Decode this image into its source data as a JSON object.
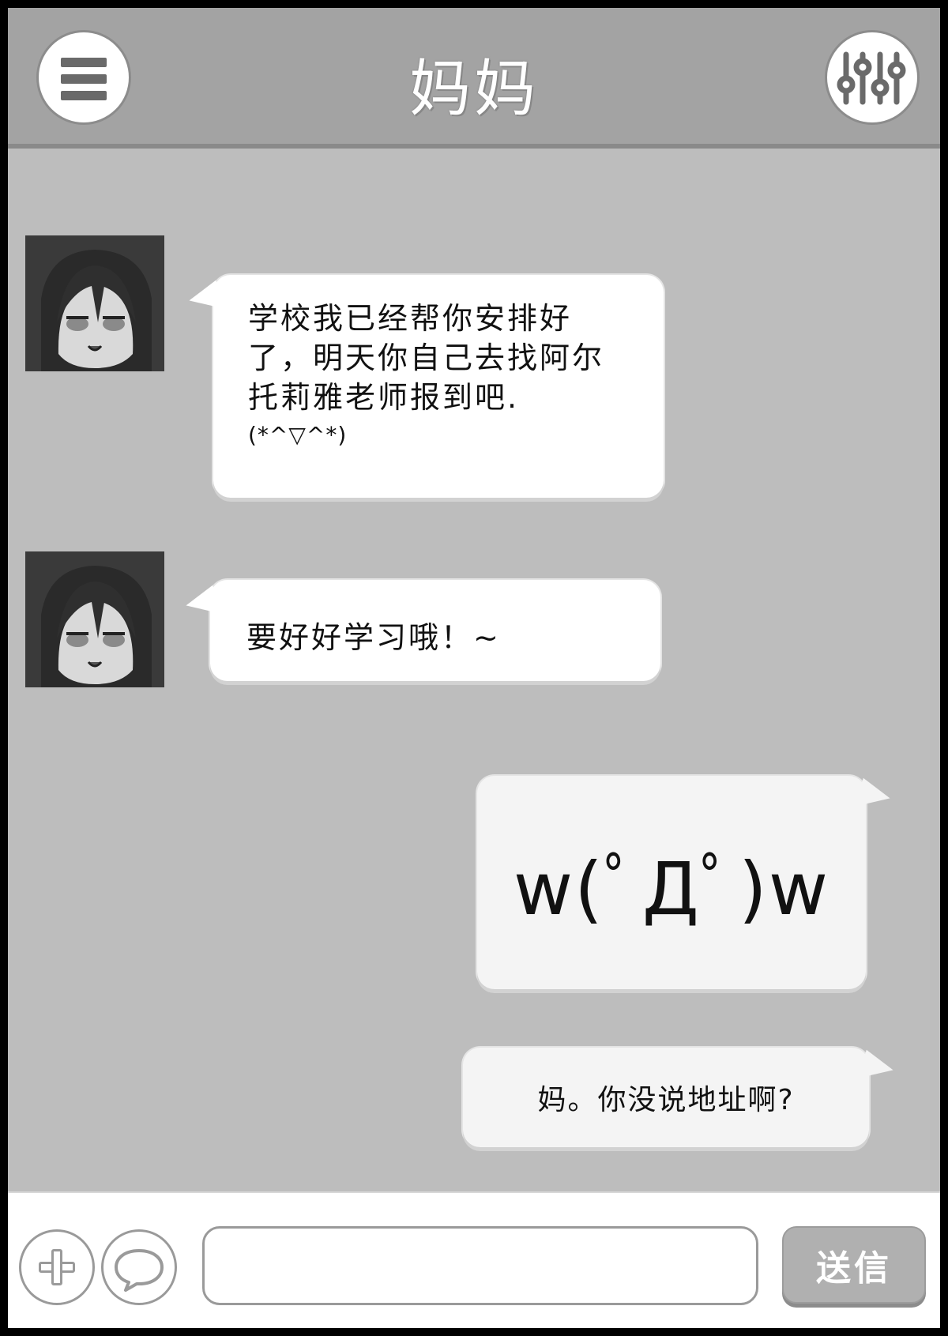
{
  "header": {
    "title": "妈妈",
    "menu_icon": "hamburger-menu-icon",
    "settings_icon": "equalizer-sliders-icon"
  },
  "messages": [
    {
      "from": "contact",
      "text": "学校我已经帮你安排好了，明天你自己去找阿尔托莉雅老师报到吧.",
      "emote": "(*^▽^*)"
    },
    {
      "from": "contact",
      "text": "要好好学习哦！~"
    },
    {
      "from": "me",
      "text": "w(ﾟДﾟ)w"
    },
    {
      "from": "me",
      "text": "妈。你没说地址啊?"
    }
  ],
  "input_bar": {
    "add_icon": "plus-icon",
    "emoji_icon": "speech-bubble-icon",
    "message_value": "",
    "send_label": "送信"
  },
  "colors": {
    "background": "#bdbdbd",
    "header": "#a3a3a3",
    "bubble": "#ffffff",
    "send_button": "#b0b0b0"
  }
}
